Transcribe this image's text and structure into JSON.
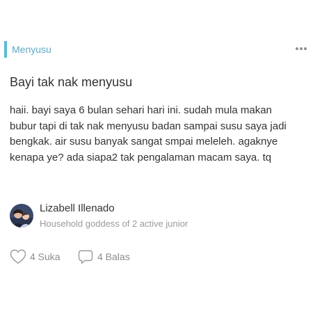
{
  "topic": {
    "label": "Menyusu",
    "accent_color": "#5bbcd2"
  },
  "menu_icon": "more-horizontal-icon",
  "post": {
    "title": "Bayi tak nak menyusu",
    "body": "haii. bayi saya 6 bulan sehari hari ini. sudah mula makan bubur tapi di tak nak menyusu badan sampai susu saya jadi bengkak. air susu banyak sangat smpai meleleh. agaknye kenapa ye? ada siapa2 tak pengalaman macam saya. tq"
  },
  "author": {
    "name": "Lizabell Illenado",
    "tagline": "Household goddess of 2 active junior"
  },
  "actions": {
    "like_label": "4 Suka",
    "like_icon": "heart-icon",
    "reply_label": "4 Balas",
    "reply_icon": "comment-icon"
  }
}
